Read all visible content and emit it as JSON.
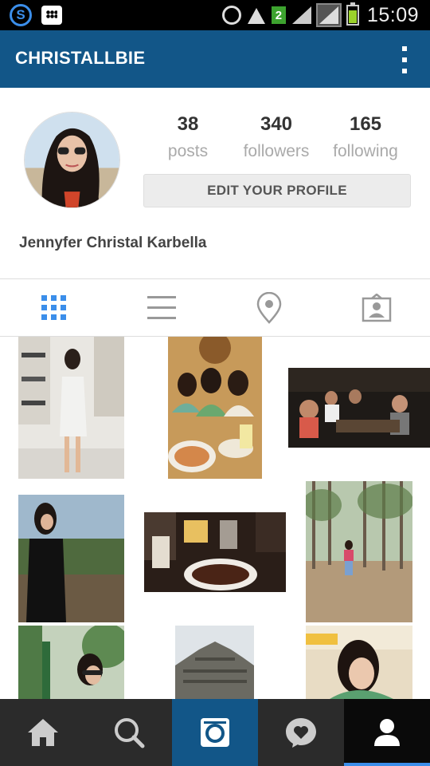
{
  "status_bar": {
    "network_badge": "2",
    "time": "15:09"
  },
  "app_bar": {
    "title": "CHRISTALLBIE"
  },
  "profile": {
    "full_name": "Jennyfer Christal Karbella",
    "stats": [
      {
        "value": "38",
        "label": "posts"
      },
      {
        "value": "340",
        "label": "followers"
      },
      {
        "value": "165",
        "label": "following"
      }
    ],
    "edit_button_label": "EDIT YOUR PROFILE"
  },
  "tabs": [
    {
      "icon": "grid-icon",
      "active": true
    },
    {
      "icon": "list-icon",
      "active": false
    },
    {
      "icon": "location-pin-icon",
      "active": false
    },
    {
      "icon": "tagged-user-icon",
      "active": false
    }
  ],
  "bottom_nav": [
    {
      "icon": "home-icon"
    },
    {
      "icon": "search-icon"
    },
    {
      "icon": "camera-icon"
    },
    {
      "icon": "activity-heart-icon"
    },
    {
      "icon": "profile-icon",
      "active": true
    }
  ],
  "colors": {
    "brand_blue": "#125688",
    "accent_blue": "#3b8eea",
    "nav_dark": "#2b2b2b"
  }
}
